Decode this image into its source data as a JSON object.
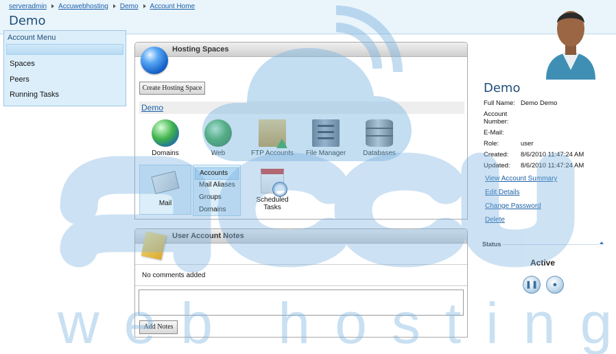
{
  "breadcrumb": [
    "serveradmin",
    "Accuwebhosting",
    "Demo",
    "Account Home"
  ],
  "page_title": "Demo",
  "account_menu": {
    "title": "Account Menu",
    "items": [
      "Spaces",
      "Peers",
      "Running Tasks"
    ]
  },
  "hosting_spaces": {
    "title": "Hosting Spaces",
    "create_button": "Create Hosting Space",
    "space_name": "Demo",
    "tools": [
      {
        "label": "Domains",
        "icon": "domains-globe-icon"
      },
      {
        "label": "Web",
        "icon": "web-globe-icon"
      },
      {
        "label": "FTP Accounts",
        "icon": "ftp-folder-icon"
      },
      {
        "label": "File Manager",
        "icon": "file-cabinet-icon"
      },
      {
        "label": "Databases",
        "icon": "database-icon"
      }
    ],
    "mail": {
      "label": "Mail",
      "submenu": [
        "Accounts",
        "Mail Aliases",
        "Groups",
        "Domains"
      ]
    },
    "scheduled_tasks": "Scheduled Tasks"
  },
  "notes": {
    "title": "User Account Notes",
    "empty_text": "No comments added",
    "add_button": "Add Notes"
  },
  "account": {
    "name": "Demo",
    "fields": [
      {
        "label": "Full Name:",
        "value": "Demo Demo"
      },
      {
        "label": "Account Number:",
        "value": ""
      },
      {
        "label": "E-Mail:",
        "value": ""
      },
      {
        "label": "Role:",
        "value": "user"
      },
      {
        "label": "Created:",
        "value": "8/6/2010 11:47:24 AM"
      },
      {
        "label": "Updated:",
        "value": "8/6/2010 11:47:24 AM"
      }
    ],
    "links": [
      "View Account Summary",
      "Edit Details",
      "Change Password",
      "Delete"
    ],
    "status_heading": "Status",
    "status_value": "Active",
    "status_buttons": [
      "pause-icon",
      "stop-icon"
    ]
  },
  "watermark": {
    "brand": "accu",
    "tagline": "web hosting",
    "color": "#7bb3e0"
  }
}
